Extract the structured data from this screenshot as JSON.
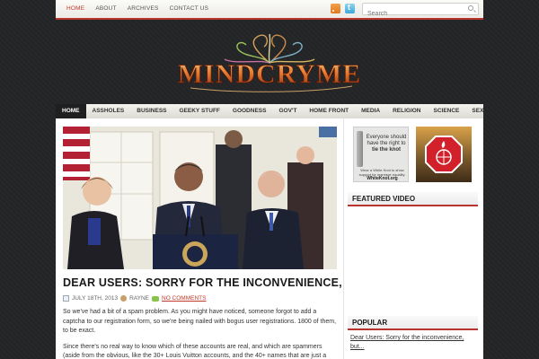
{
  "topbar": {
    "nav": [
      {
        "label": "HOME",
        "active": true
      },
      {
        "label": "ABOUT",
        "active": false
      },
      {
        "label": "ARCHIVES",
        "active": false
      },
      {
        "label": "CONTACT US",
        "active": false
      }
    ],
    "search_placeholder": "Search",
    "icons": [
      "rss-icon",
      "twitter-icon",
      "search-icon"
    ]
  },
  "logo": {
    "text": "MINDCRYME"
  },
  "mainnav": [
    {
      "label": "HOME",
      "active": true
    },
    {
      "label": "ASSHOLES"
    },
    {
      "label": "BUSINESS"
    },
    {
      "label": "GEEKY STUFF"
    },
    {
      "label": "GOODNESS"
    },
    {
      "label": "GOV'T"
    },
    {
      "label": "HOME FRONT"
    },
    {
      "label": "MEDIA"
    },
    {
      "label": "RELIGION"
    },
    {
      "label": "SCIENCE"
    },
    {
      "label": "SEX"
    }
  ],
  "post": {
    "title": "DEAR USERS: SORRY FOR THE INCONVENIENCE, BUT...",
    "date": "JULY 18TH, 2013",
    "author": "RAYNE",
    "comments": "NO COMMENTS",
    "paragraphs": [
      "So we've had a bit of a spam problem. As you might have noticed, someone forgot to add a captcha to our registration form, so we're being nailed with bogus user registrations. 1800 of them, to be exact.",
      "Since there's no real way to know which of these accounts are real, and which are spammers (aside from the obvious, like the 30+ Louis Vuitton accounts, and the 40+ names that are just a"
    ]
  },
  "sidebar": {
    "ad1": {
      "line1": "Everyone should",
      "line2": "have the right to",
      "line3": "tie the knot",
      "small": "Wear a White Knot to show support for marriage equality.",
      "url": "WhiteKnot.org"
    },
    "featured_title": "FEATURED VIDEO",
    "popular_title": "POPULAR",
    "popular_items": [
      "Dear Users: Sorry for the inconvenience, but..."
    ]
  },
  "colors": {
    "accent": "#b9342c",
    "nav_active": "#1f1f1f",
    "link": "#c0392b"
  }
}
